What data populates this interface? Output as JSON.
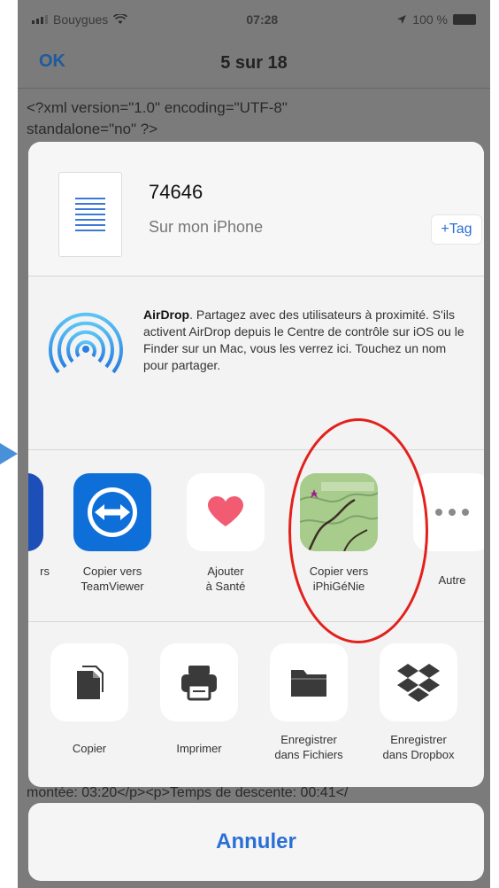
{
  "status_bar": {
    "carrier": "Bouygues",
    "time": "07:28",
    "battery": "100 %"
  },
  "nav": {
    "ok_label": "OK",
    "title": "5 sur 18"
  },
  "document": {
    "line1": "<?xml version=\"1.0\" encoding=\"UTF-8\"",
    "line2": "standalone=\"no\" ?>",
    "bottom_line": "montée: 03:20</p><p>Temps de descente: 00:41</"
  },
  "file": {
    "name": "74646",
    "location": "Sur mon iPhone",
    "tag_label": "+Tag"
  },
  "airdrop": {
    "title": "AirDrop",
    "description": ". Partagez avec des utilisateurs à proximité. S'ils activent AirDrop depuis le Centre de contrôle sur iOS ou le Finder sur un Mac, vous les verrez ici. Touchez un nom pour partager."
  },
  "apps": [
    {
      "label_line1": "Copier vers",
      "label_line2": "TeamViewer",
      "icon": "teamviewer-icon"
    },
    {
      "label_line1": "Ajouter",
      "label_line2": "à Santé",
      "icon": "heart-icon"
    },
    {
      "label_line1": "Copier vers",
      "label_line2": "iPhiGéNie",
      "icon": "map-icon"
    },
    {
      "label_line1": "Autre",
      "label_line2": "",
      "icon": "more-icon"
    }
  ],
  "partial_app_label": "rs",
  "actions": [
    {
      "label_line1": "Copier",
      "label_line2": "",
      "icon": "copy-icon"
    },
    {
      "label_line1": "Imprimer",
      "label_line2": "",
      "icon": "print-icon"
    },
    {
      "label_line1": "Enregistrer",
      "label_line2": "dans Fichiers",
      "icon": "folder-icon"
    },
    {
      "label_line1": "Enregistrer",
      "label_line2": "dans Dropbox",
      "icon": "dropbox-icon"
    }
  ],
  "cancel_label": "Annuler",
  "colors": {
    "accent_blue": "#2a6fd6",
    "highlight_red": "#e3201b",
    "teamviewer_blue": "#0e6fd8",
    "heart_pink": "#f25c73"
  }
}
